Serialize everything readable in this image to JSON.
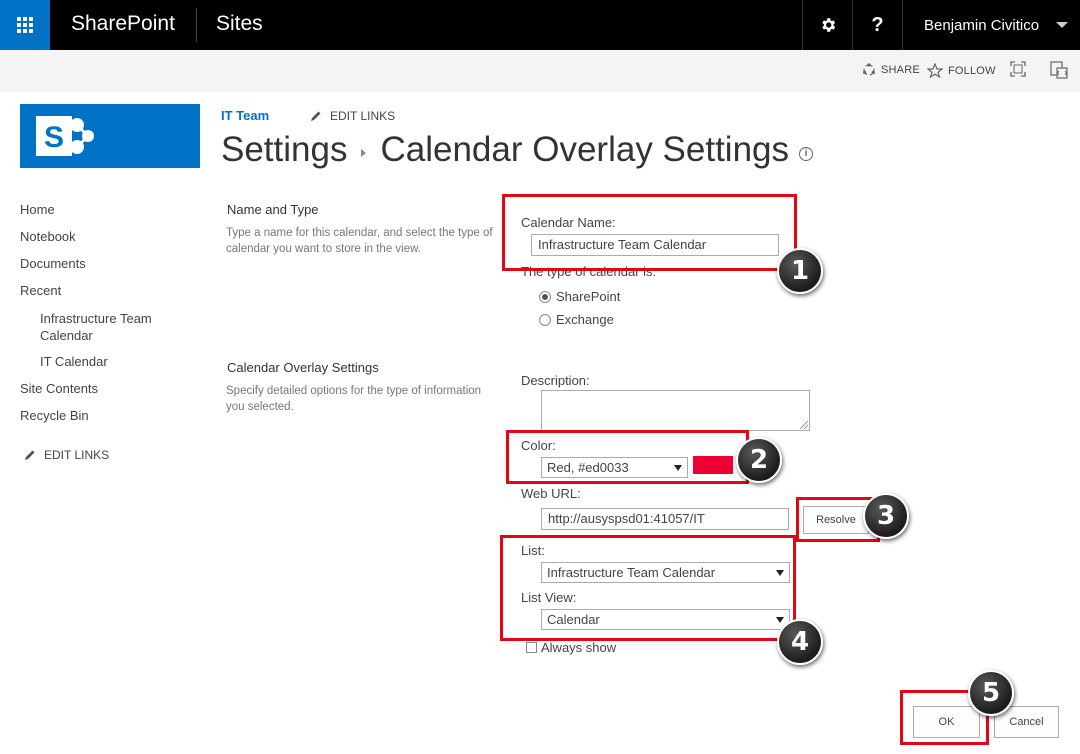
{
  "suitebar": {
    "brand": "SharePoint",
    "sites": "Sites",
    "help": "?",
    "user": "Benjamin Civitico"
  },
  "ribbon": {
    "share": "SHARE",
    "follow": "FOLLOW"
  },
  "header": {
    "site_title": "IT Team",
    "edit_links": "EDIT LINKS",
    "breadcrumb_root": "Settings",
    "page_title": "Calendar Overlay Settings",
    "info": "i"
  },
  "quick_launch": {
    "items": [
      "Home",
      "Notebook",
      "Documents",
      "Recent"
    ],
    "recent_sub": [
      "Infrastructure Team Calendar",
      "IT Calendar"
    ],
    "tail": [
      "Site Contents",
      "Recycle Bin"
    ],
    "edit_links": "EDIT LINKS"
  },
  "name_type": {
    "title": "Name and Type",
    "desc": "Type a name for this calendar, and select the type of calendar you want to store in the view.",
    "calendar_name_label": "Calendar Name:",
    "calendar_name_value": "Infrastructure Team Calendar",
    "type_label": "The type of calendar is:",
    "type_options": [
      "SharePoint",
      "Exchange"
    ],
    "type_selected": "SharePoint"
  },
  "overlay": {
    "title": "Calendar Overlay Settings",
    "desc": "Specify detailed options for the type of information you selected.",
    "description_label": "Description:",
    "color_label": "Color:",
    "color_value": "Red, #ed0033",
    "color_hex": "#ed0033",
    "web_url_label": "Web URL:",
    "web_url_value": "http://ausyspsd01:41057/IT",
    "resolve_label": "Resolve",
    "list_label": "List:",
    "list_value": "Infrastructure Team Calendar",
    "list_view_label": "List View:",
    "list_view_value": "Calendar",
    "always_show_label": "Always show"
  },
  "buttons": {
    "ok": "OK",
    "cancel": "Cancel"
  },
  "annotations": {
    "badges": [
      "1",
      "2",
      "3",
      "4",
      "5"
    ],
    "highlight_color": "#e30613"
  }
}
